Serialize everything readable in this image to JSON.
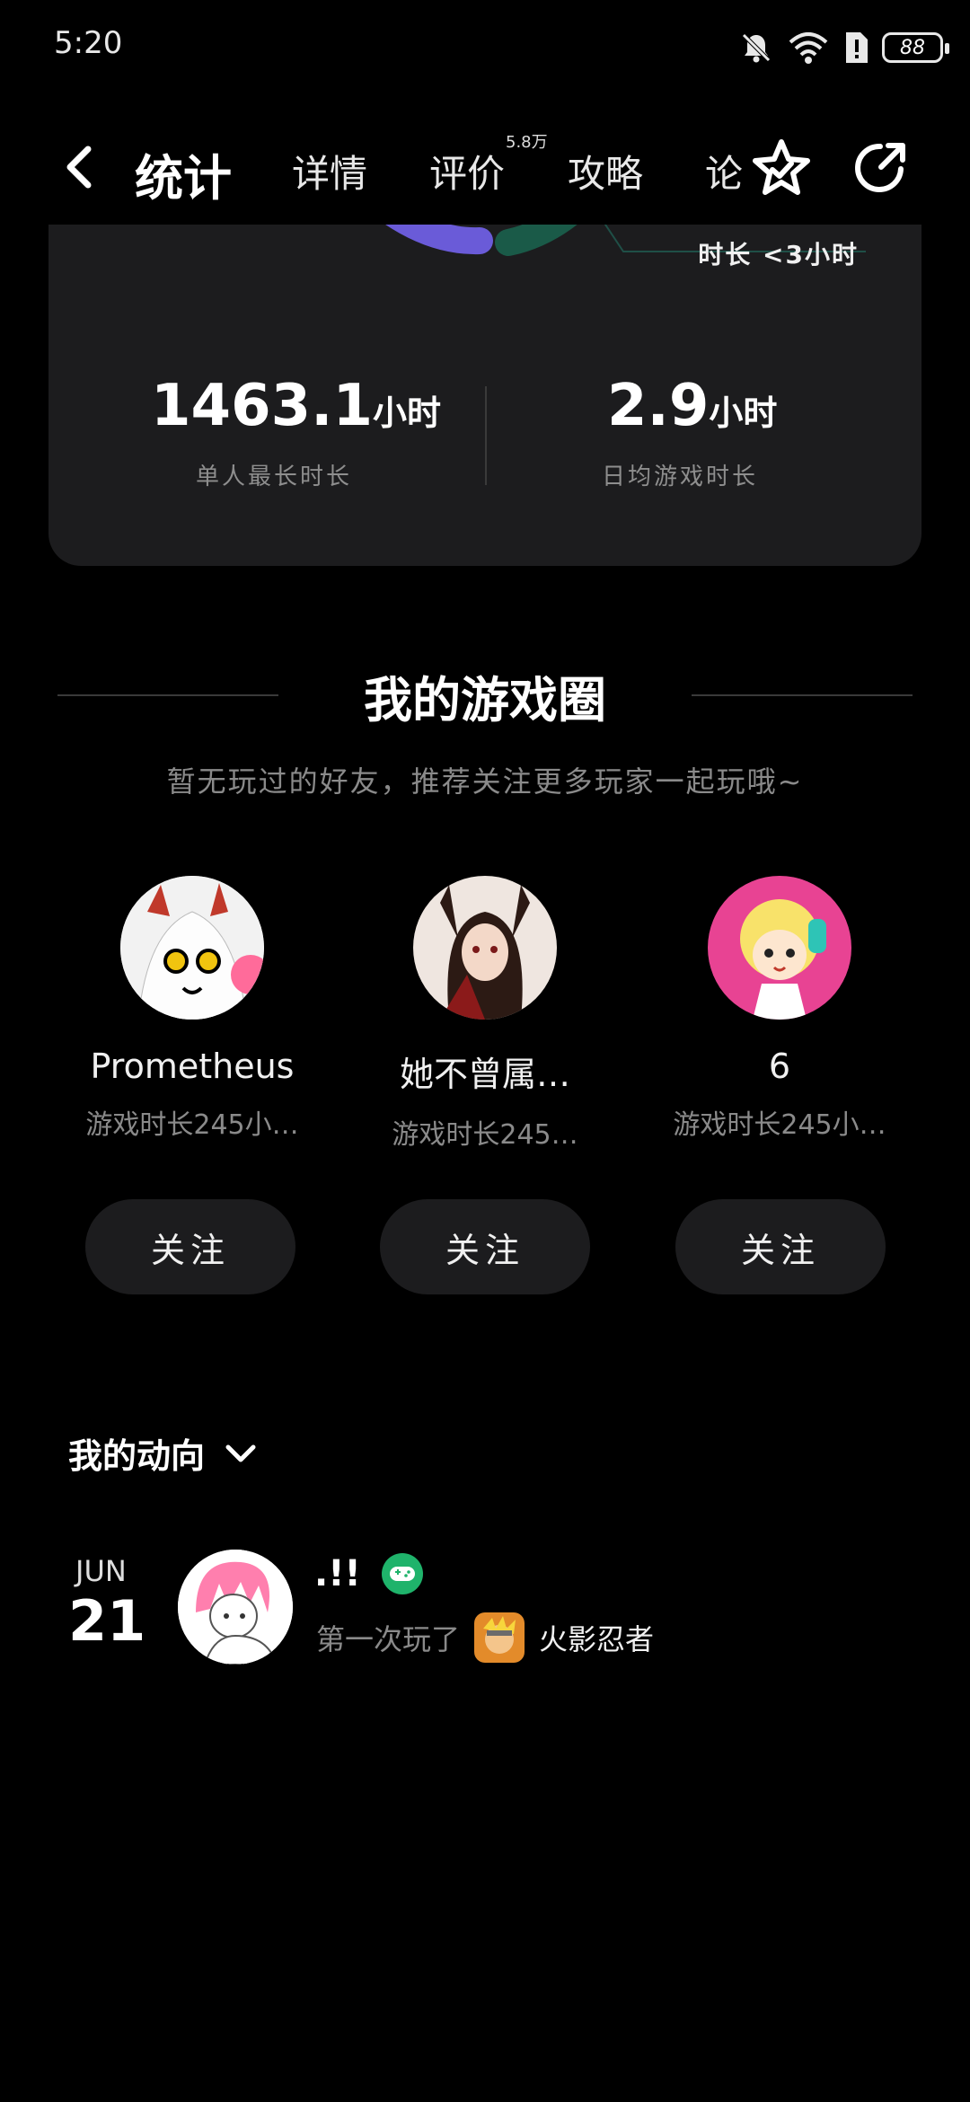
{
  "status": {
    "time": "5:20",
    "battery": "88"
  },
  "nav": {
    "tabs": [
      "统计",
      "详情",
      "评价",
      "攻略",
      "论"
    ],
    "reviews_count": "5.8万"
  },
  "stats": {
    "bubble_label": "时长 <3小时",
    "left": {
      "value": "1463.1",
      "unit": "小时",
      "label": "单人最长时长"
    },
    "right": {
      "value": "2.9",
      "unit": "小时",
      "label": "日均游戏时长"
    }
  },
  "circle": {
    "title": "我的游戏圈",
    "hint": "暂无玩过的好友，推荐关注更多玩家一起玩哦~",
    "friends": [
      {
        "name": "Prometheus",
        "time": "游戏时长245小…",
        "follow": "关注"
      },
      {
        "name": "她不曾属…",
        "time": "游戏时长245…",
        "follow": "关注"
      },
      {
        "name": "6",
        "time": "游戏时长245小…",
        "follow": "关注"
      }
    ]
  },
  "dynamics": {
    "title": "我的动向",
    "month": "JUN",
    "day": "21",
    "user": ".!!",
    "action": "第一次玩了",
    "game": "火影忍者"
  },
  "colors": {
    "accent": "#18b49a",
    "card": "#1c1c1e",
    "bg": "#000000"
  }
}
